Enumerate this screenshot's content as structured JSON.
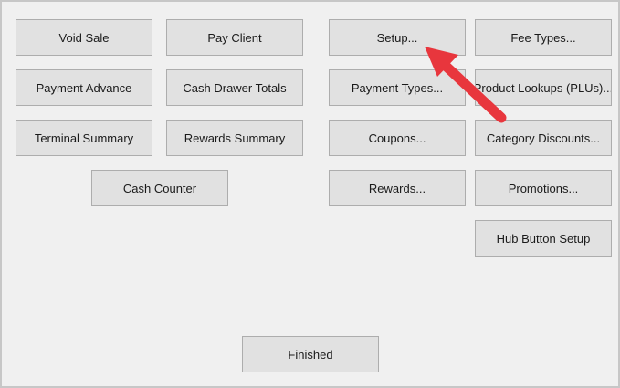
{
  "left_panel": {
    "void_sale": "Void Sale",
    "pay_client": "Pay Client",
    "payment_advance": "Payment Advance",
    "cash_drawer_totals": "Cash Drawer Totals",
    "terminal_summary": "Terminal Summary",
    "rewards_summary": "Rewards Summary",
    "cash_counter": "Cash Counter"
  },
  "right_panel": {
    "setup": "Setup...",
    "fee_types": "Fee Types...",
    "payment_types": "Payment Types...",
    "product_lookups": "Product Lookups (PLUs)...",
    "coupons": "Coupons...",
    "category_discounts": "Category Discounts...",
    "rewards": "Rewards...",
    "promotions": "Promotions...",
    "hub_button_setup": "Hub Button Setup"
  },
  "footer": {
    "finished": "Finished"
  },
  "annotation": {
    "arrow_color": "#e8363d"
  }
}
